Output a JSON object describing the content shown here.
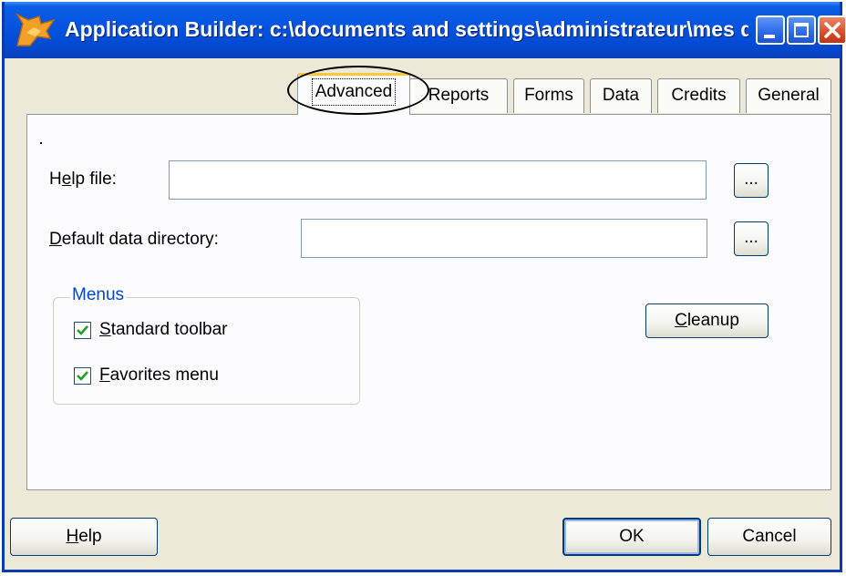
{
  "window": {
    "title": "Application Builder: c:\\documents and settings\\administrateur\\mes d...",
    "app_icon": "fox-icon",
    "controls": [
      "minimize-icon",
      "maximize-icon",
      "close-icon"
    ]
  },
  "tabs": [
    {
      "label": "Advanced",
      "active": true
    },
    {
      "label": "Reports"
    },
    {
      "label": "Forms"
    },
    {
      "label": "Data"
    },
    {
      "label": "Credits"
    },
    {
      "label": "General"
    }
  ],
  "panel": {
    "dot": ".",
    "help_file": {
      "label_u": "e",
      "label_pre": "H",
      "label_post": "lp file:",
      "value": "",
      "browse": "..."
    },
    "data_dir": {
      "label_u": "D",
      "label_post": "efault data directory:",
      "value": "",
      "browse": "..."
    },
    "menus": {
      "title": "Menus",
      "standard_toolbar": {
        "u": "S",
        "rest": "tandard toolbar",
        "checked": true
      },
      "favorites_menu": {
        "u": "F",
        "rest": "avorites menu",
        "checked": true
      }
    },
    "cleanup": {
      "u": "C",
      "rest": "leanup"
    }
  },
  "footer": {
    "help": {
      "u": "H",
      "rest": "elp"
    },
    "ok": "OK",
    "cancel": "Cancel"
  },
  "colors": {
    "titlebar": "#0553e0",
    "dialog_bg": "#ece9d8",
    "group_title": "#0046d5",
    "checkmark": "#21a121",
    "active_tab_accent": "#ffc73c"
  }
}
